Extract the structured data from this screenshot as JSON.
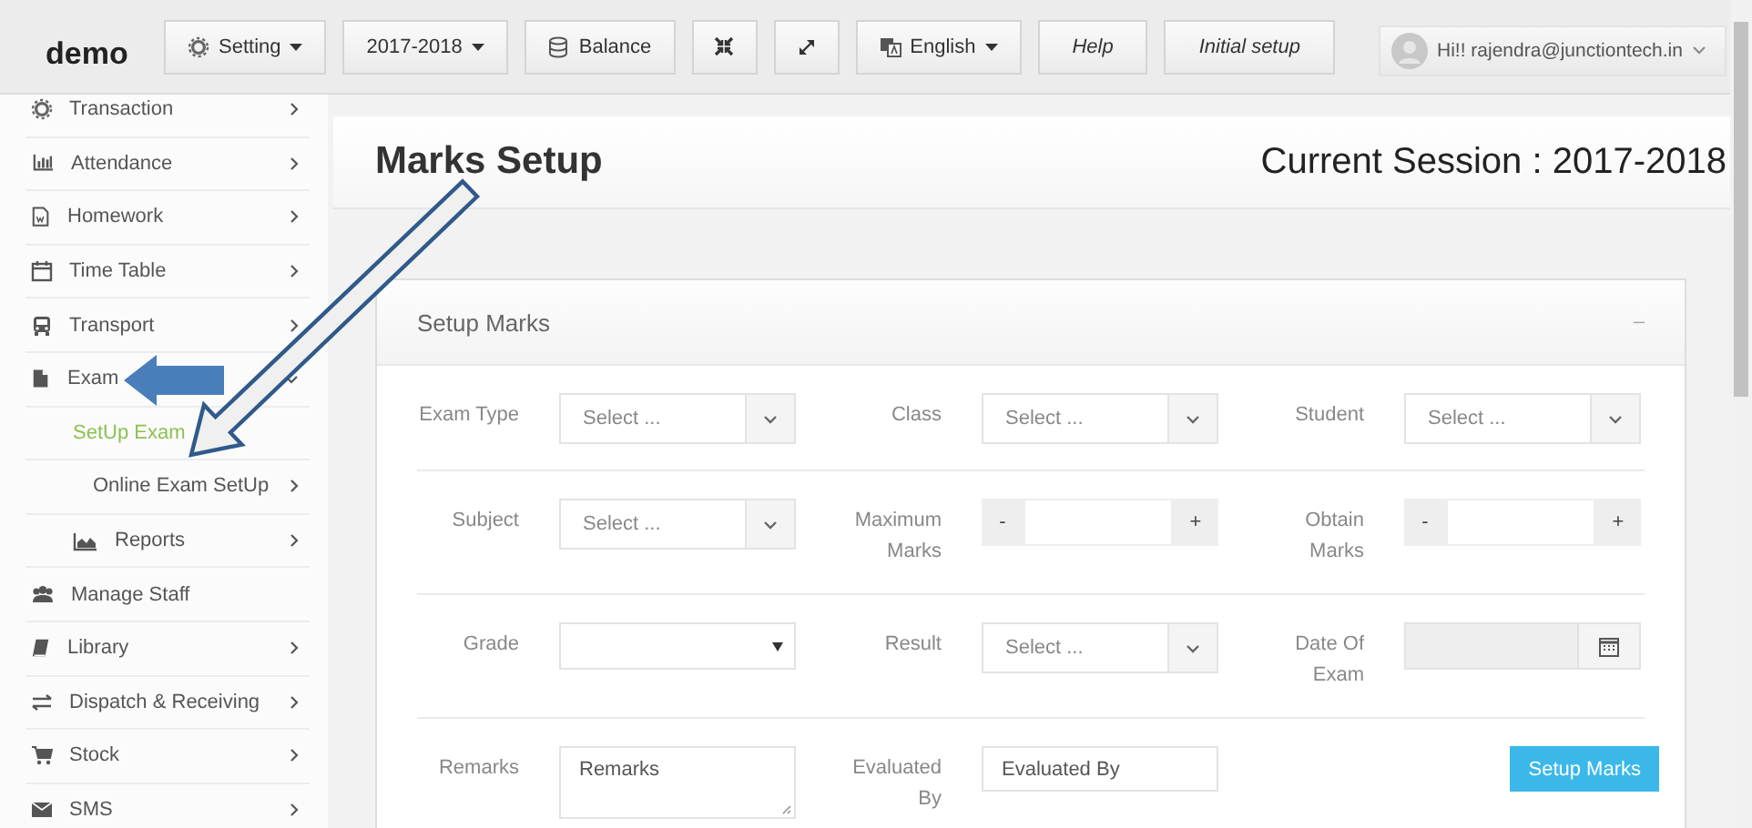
{
  "topbar": {
    "brand": "demo",
    "buttons": [
      {
        "label": "Setting",
        "kind": "dropdown"
      },
      {
        "label": "2017-2018",
        "kind": "dropdown"
      },
      {
        "label": "Balance",
        "kind": "button"
      },
      {
        "kind": "icon"
      },
      {
        "kind": "icon"
      },
      {
        "label": "English",
        "kind": "dropdown"
      },
      {
        "label": "Help",
        "kind": "link"
      },
      {
        "label": "Initial setup",
        "kind": "link"
      }
    ],
    "user": "Hi!! rajendra@junctiontech.in"
  },
  "sidebar": {
    "items": [
      {
        "label": "Transaction",
        "expanded": false,
        "selected": false
      },
      {
        "label": "Attendance",
        "expanded": false,
        "selected": false
      },
      {
        "label": "Homework",
        "expanded": false,
        "selected": false
      },
      {
        "label": "Time Table",
        "expanded": false,
        "selected": false
      },
      {
        "label": "Transport",
        "expanded": false,
        "selected": false
      },
      {
        "label": "Exam",
        "expanded": true,
        "selected": false,
        "children": [
          {
            "label": "SetUp Exam",
            "selected": true
          },
          {
            "label": "Online Exam SetUp",
            "expanded": false,
            "selected": false
          },
          {
            "label": "Reports",
            "expanded": false,
            "selected": false
          }
        ]
      },
      {
        "label": "Manage Staff",
        "selected": false
      },
      {
        "label": "Library",
        "expanded": false,
        "selected": false
      },
      {
        "label": "Dispatch & Receiving",
        "expanded": false,
        "selected": false
      },
      {
        "label": "Stock",
        "expanded": false,
        "selected": false
      },
      {
        "label": "SMS",
        "expanded": false,
        "selected": false
      }
    ]
  },
  "page": {
    "title": "Marks Setup",
    "session": "Current Session : 2017-2018"
  },
  "card": {
    "title": "Setup Marks",
    "collapse": "–",
    "rows": [
      [
        {
          "label": "Exam Type",
          "kind": "select",
          "placeholder": "Select ..."
        },
        {
          "label": "Class",
          "kind": "select",
          "placeholder": "Select ..."
        },
        {
          "label": "Student",
          "kind": "select",
          "placeholder": "Select ..."
        }
      ],
      [
        {
          "label": "Subject",
          "kind": "select",
          "placeholder": "Select ..."
        },
        {
          "label": "Maximum Marks",
          "kind": "spinner",
          "minus": "-",
          "plus": "+"
        },
        {
          "label": "Obtain Marks",
          "kind": "spinner",
          "minus": "-",
          "plus": "+"
        }
      ],
      [
        {
          "label": "Grade",
          "kind": "native-select"
        },
        {
          "label": "Result",
          "kind": "select",
          "placeholder": "Select ..."
        },
        {
          "label": "Date Of Exam",
          "kind": "date",
          "disabled": true
        }
      ],
      [
        {
          "label": "Remarks",
          "kind": "textarea",
          "value": "Remarks"
        },
        {
          "label": "Evaluated By",
          "kind": "text",
          "value": "Evaluated By"
        },
        {
          "kind": "button",
          "label": "Setup Marks"
        }
      ]
    ]
  }
}
